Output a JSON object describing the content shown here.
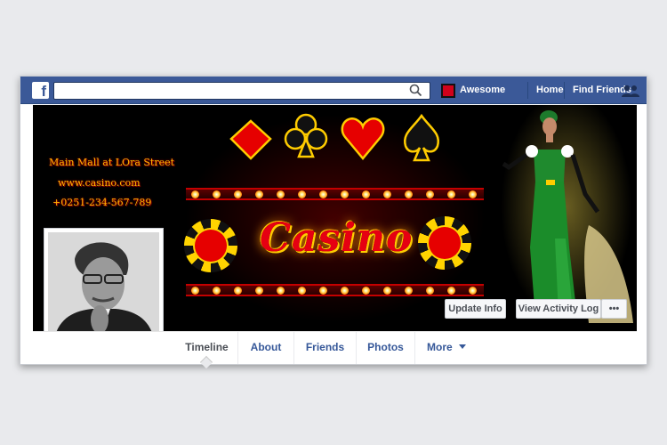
{
  "topbar": {
    "search_placeholder": "",
    "profile_name": "Awesome",
    "links": [
      "Home",
      "Find Friends"
    ]
  },
  "cover": {
    "contact_lines": [
      "Main Mall at LOra Street",
      "www.casino.com",
      "+0251-234-567-789"
    ],
    "title": "Casino",
    "buttons": {
      "update_info": "Update Info",
      "view_activity_log": "View Activity Log",
      "more": "•••"
    }
  },
  "tabs": [
    {
      "label": "Timeline"
    },
    {
      "label": "About"
    },
    {
      "label": "Friends"
    },
    {
      "label": "Photos"
    },
    {
      "label": "More"
    }
  ],
  "colors": {
    "facebook_blue": "#3b5998",
    "casino_red": "#e60012",
    "casino_gold": "#ffcc00",
    "page_bg": "#e9eaed"
  },
  "icons": [
    "facebook-logo-icon",
    "search-icon",
    "friend-requests-icon",
    "chevron-down-icon"
  ]
}
